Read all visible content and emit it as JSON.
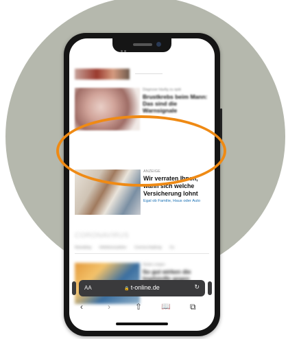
{
  "articles": [
    {
      "kicker": "Diagnose häufig zu spät",
      "headline": "Brustkrebs beim Mann: Das sind die Warnsignale",
      "subline": ""
    },
    {
      "kicker": "ANZEIGE",
      "headline": "Wir verraten Ihnen, wann sich welche Versicherung lohnt",
      "subline": "Egal ob Familie, Haus oder Auto"
    },
    {
      "kicker": "Skalen zeigen",
      "headline": "So gut wirken die Impfstoffe gegen Omikron",
      "subline": ""
    }
  ],
  "section": {
    "title": "CORONAVIRUS",
    "tags": [
      "Newsblog",
      "Infektionszahlen",
      "Corona-Impfung",
      "Co"
    ]
  },
  "browser": {
    "aa_label": "AA",
    "url": "t-online.de",
    "icons": [
      "lock-icon",
      "reload-icon",
      "back-icon",
      "forward-icon",
      "share-icon",
      "bookmarks-icon",
      "tabs-icon"
    ]
  },
  "colors": {
    "highlight": "#ef8a14",
    "background_circle": "#b5b8ad",
    "link_blue": "#1b71b5"
  }
}
